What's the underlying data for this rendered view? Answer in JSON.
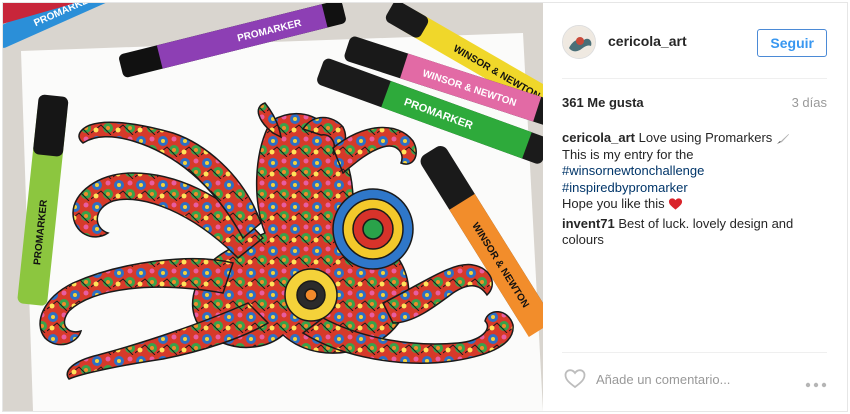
{
  "post": {
    "username": "cericola_art",
    "follow_label": "Seguir",
    "likes": "361 Me gusta",
    "age": "3 días",
    "caption": {
      "user": "cericola_art",
      "line1": "Love using Promarkers",
      "line2": "This is my entry for the",
      "hashtag1": "#winsornewtonchallenge",
      "hashtag2": "#inspiredbypromarker",
      "line5": "Hope you like this"
    },
    "comments": [
      {
        "user": "invent71",
        "text": "Best of luck. lovely design and colours"
      }
    ],
    "add_comment_placeholder": "Añade un comentario..."
  },
  "image": {
    "marker_labels": [
      "PROMARKER",
      "WINSOR & NEWTON"
    ]
  },
  "icons": {
    "like": "heart-outline-icon",
    "more": "more-options-icon",
    "emoji_heart": "red-heart-icon",
    "emoji_brush": "paintbrush-icon"
  },
  "colors": {
    "link": "#003569",
    "button": "#3897f0",
    "muted": "#999999",
    "heart": "#d9242b"
  }
}
